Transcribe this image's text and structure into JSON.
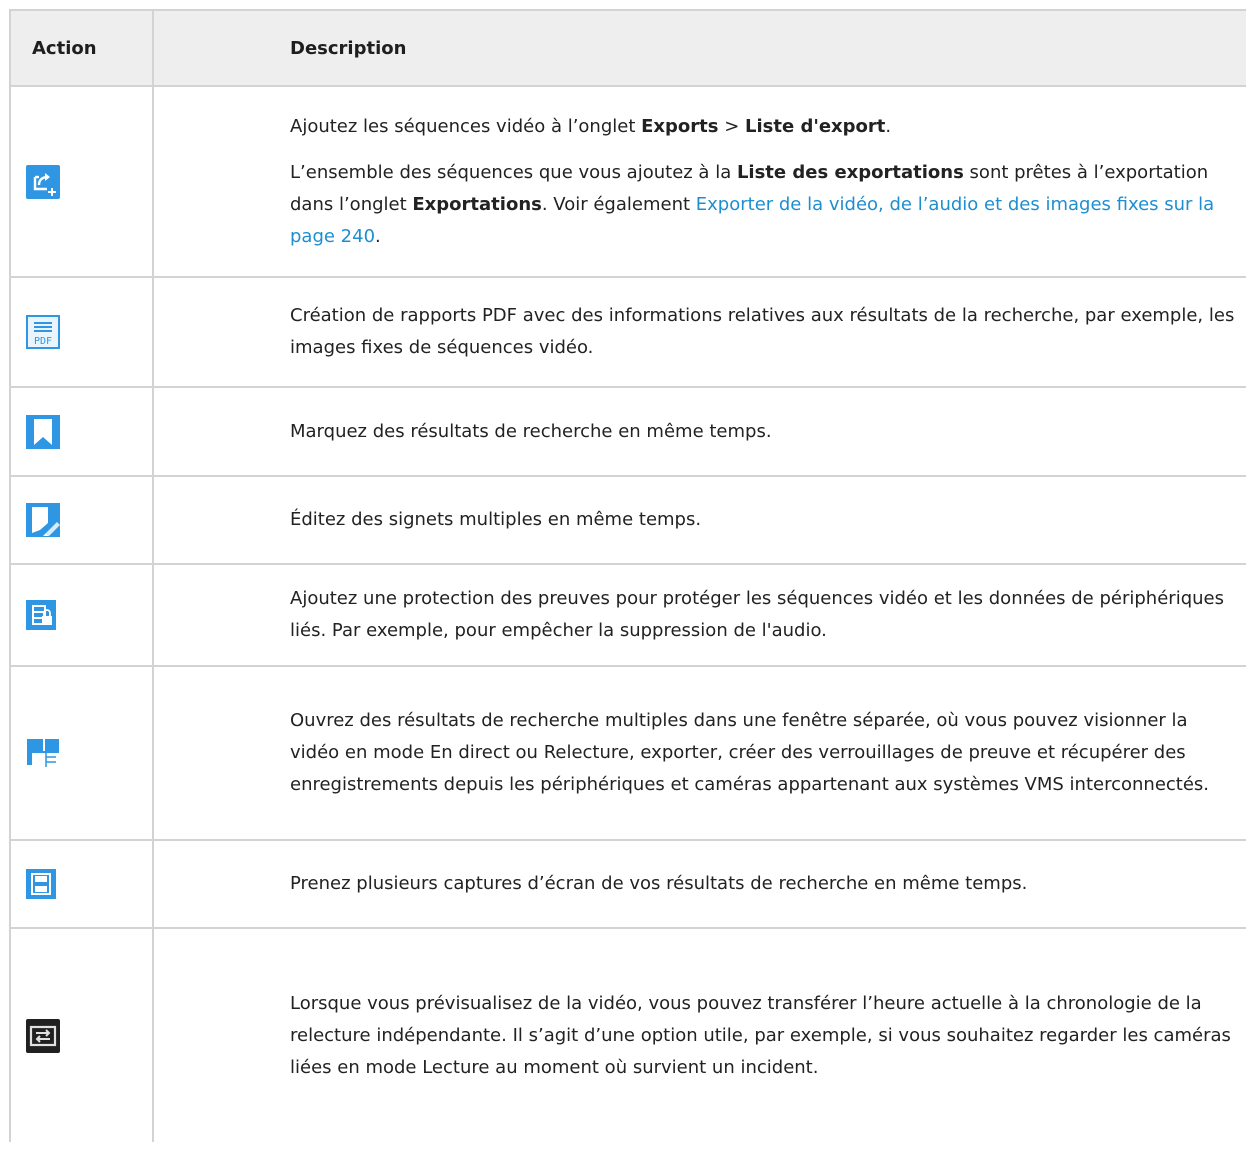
{
  "header": {
    "action": "Action",
    "description": "Description"
  },
  "rows": [
    {
      "icon": "add-to-export-list-icon",
      "p1": {
        "t1": "Ajoutez les séquences vidéo à l’onglet ",
        "b1": "Exports",
        "t2": " > ",
        "b2": "Liste d'export",
        "t3": "."
      },
      "p2": {
        "t1": "L’ensemble des séquences que vous ajoutez à la ",
        "b1": "Liste des exportations",
        "t2": " sont prêtes à l’exportation dans l’onglet ",
        "b2": "Exportations",
        "t3": ". Voir également ",
        "link": "Exporter de la vidéo, de l’audio et des images fixes sur la page 240",
        "t4": "."
      }
    },
    {
      "icon": "pdf-report-icon",
      "icon_text": "PDF",
      "text": "Création de rapports PDF avec des informations relatives aux résultats de la recherche, par exemple, les images fixes de séquences vidéo."
    },
    {
      "icon": "bookmark-icon",
      "text": "Marquez des résultats de recherche en même temps."
    },
    {
      "icon": "edit-bookmark-icon",
      "text": "Éditez des signets multiples en même temps."
    },
    {
      "icon": "evidence-lock-icon",
      "text": "Ajoutez une protection des preuves pour protéger les séquences vidéo et les données de périphériques liés. Par exemple, pour empêcher la suppression de l'audio."
    },
    {
      "icon": "open-in-window-icon",
      "text": "Ouvrez des résultats de recherche multiples dans une fenêtre séparée, où vous pouvez visionner la vidéo en mode En direct ou Relecture, exporter, créer des verrouillages de preuve et récupérer des enregistrements depuis les périphériques et caméras appartenant aux systèmes VMS interconnectés."
    },
    {
      "icon": "save-snapshot-icon",
      "text": "Prenez plusieurs captures d’écran de vos résultats de recherche en même temps."
    },
    {
      "icon": "transfer-time-icon",
      "text": "Lorsque vous prévisualisez de la vidéo, vous pouvez transférer l’heure actuelle à la chronologie de la relecture indépendante. Il s’agit d’une option utile, par exemple, si vous souhaitez regarder les caméras liées en mode Lecture au moment où survient un incident."
    }
  ],
  "colors": {
    "icon_blue": "#2f96e3",
    "icon_dark": "#202020",
    "link": "#1d8fd0",
    "header_bg": "#eeeeee",
    "border": "#d3d3d3"
  }
}
